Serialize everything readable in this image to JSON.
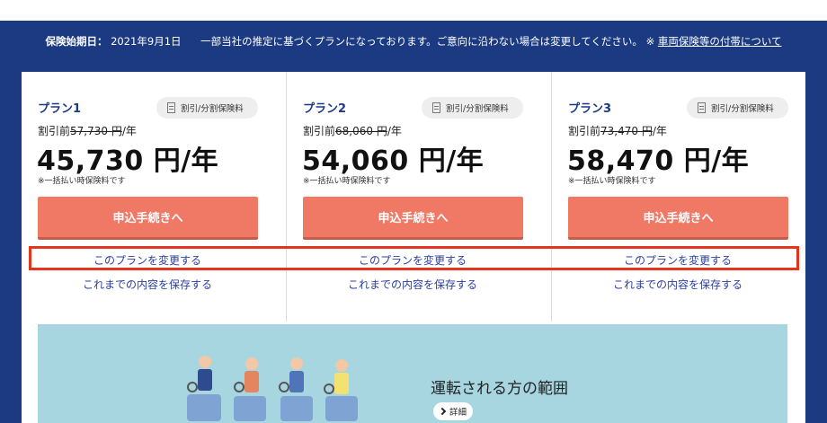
{
  "notice": {
    "label": "保険始期日：",
    "date": "2021年9月1日",
    "message": "一部当社の推定に基づくプランになっております。ご意向に沿わない場合は変更してください。",
    "link_prefix": "※",
    "link": "車両保険等の付帯について"
  },
  "plans": [
    {
      "name": "プラン1",
      "discount_label": "割引/分割保険料",
      "before_label": "割引前",
      "before_price": "57,730 円",
      "before_unit": "/年",
      "price": "45,730 円/年",
      "note": "※一括払い時保険料です",
      "apply_label": "申込手続きへ",
      "change_label": "このプランを変更する",
      "save_label": "これまでの内容を保存する"
    },
    {
      "name": "プラン2",
      "discount_label": "割引/分割保険料",
      "before_label": "割引前",
      "before_price": "68,060 円",
      "before_unit": "/年",
      "price": "54,060 円/年",
      "note": "※一括払い時保険料です",
      "apply_label": "申込手続きへ",
      "change_label": "このプランを変更する",
      "save_label": "これまでの内容を保存する"
    },
    {
      "name": "プラン3",
      "discount_label": "割引/分割保険料",
      "before_label": "割引前",
      "before_price": "73,470 円",
      "before_unit": "/年",
      "price": "58,470 円/年",
      "note": "※一括払い時保険料です",
      "apply_label": "申込手続きへ",
      "change_label": "このプランを変更する",
      "save_label": "これまでの内容を保存する"
    }
  ],
  "banner": {
    "title": "運転される方の範囲",
    "detail_label": "詳細",
    "illustration": "people-in-seats-illustration"
  },
  "colors": {
    "navy": "#1c3a82",
    "accent": "#f07966",
    "link": "#2b3f9e",
    "highlight": "#e5341c",
    "banner": "#a7d6e0"
  }
}
